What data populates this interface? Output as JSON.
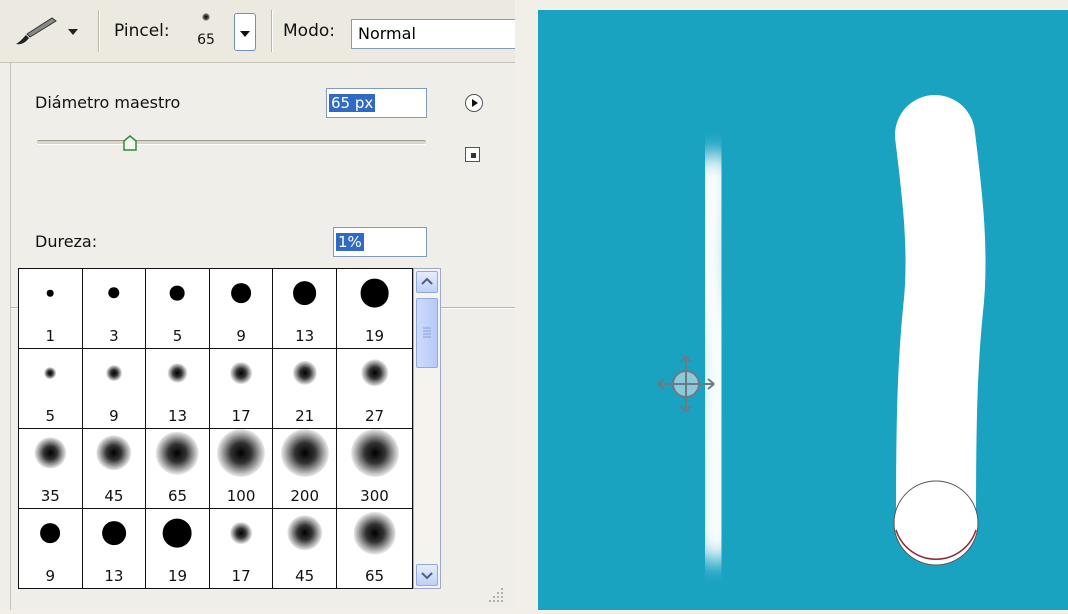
{
  "options_bar": {
    "tool_icon": "brush-icon",
    "pincel_label": "Pincel:",
    "pincel_size": "65",
    "modo_label": "Modo:",
    "modo_value": "Normal"
  },
  "brush_panel": {
    "diameter_label": "Diámetro maestro",
    "diameter_value": "65 px",
    "diameter_slider_fraction": 0.24,
    "hardness_label": "Dureza:",
    "hardness_value": "1%",
    "hardness_slider_fraction": 0.01,
    "menu_icon": "flyout-menu-icon",
    "new_preset_icon": "new-preset-icon"
  },
  "presets": [
    {
      "size": "1",
      "hard": true
    },
    {
      "size": "3",
      "hard": true
    },
    {
      "size": "5",
      "hard": true
    },
    {
      "size": "9",
      "hard": true
    },
    {
      "size": "13",
      "hard": true
    },
    {
      "size": "19",
      "hard": true
    },
    {
      "size": "5",
      "hard": false
    },
    {
      "size": "9",
      "hard": false
    },
    {
      "size": "13",
      "hard": false
    },
    {
      "size": "17",
      "hard": false
    },
    {
      "size": "21",
      "hard": false
    },
    {
      "size": "27",
      "hard": false
    },
    {
      "size": "35",
      "hard": false
    },
    {
      "size": "45",
      "hard": false
    },
    {
      "size": "65",
      "hard": false
    },
    {
      "size": "100",
      "hard": false
    },
    {
      "size": "200",
      "hard": false
    },
    {
      "size": "300",
      "hard": false
    },
    {
      "size": "9",
      "hard": true
    },
    {
      "size": "13",
      "hard": true
    },
    {
      "size": "19",
      "hard": true
    },
    {
      "size": "17",
      "hard": false
    },
    {
      "size": "45",
      "hard": false
    },
    {
      "size": "65",
      "hard": false
    }
  ],
  "colors": {
    "canvas": "#1aa2c1",
    "stroke": "#ffffff",
    "selection": "#316ac5"
  }
}
